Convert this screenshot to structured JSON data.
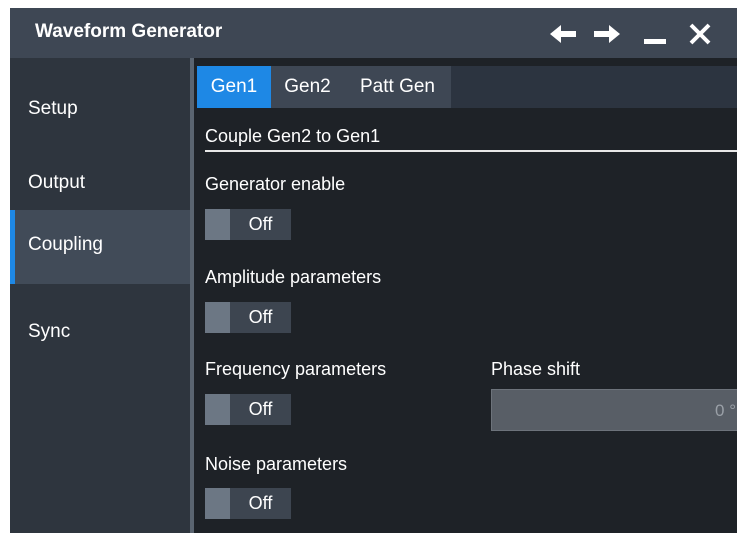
{
  "window": {
    "title": "Waveform Generator",
    "icons": [
      "back-arrow-icon",
      "forward-arrow-icon",
      "minimize-icon",
      "close-icon"
    ]
  },
  "sidebar": {
    "items": [
      {
        "label": "Setup",
        "active": false
      },
      {
        "label": "Output",
        "active": false
      },
      {
        "label": "Coupling",
        "active": true
      },
      {
        "label": "Sync",
        "active": false
      }
    ]
  },
  "tabs": [
    {
      "label": "Gen1",
      "active": true
    },
    {
      "label": "Gen2",
      "active": false
    },
    {
      "label": "Patt Gen",
      "active": false
    }
  ],
  "content": {
    "section_title": "Couple Gen2 to Gen1",
    "generator_enable": {
      "label": "Generator enable",
      "state": "Off"
    },
    "amplitude_parameters": {
      "label": "Amplitude parameters",
      "state": "Off"
    },
    "frequency_parameters": {
      "label": "Frequency parameters",
      "state": "Off"
    },
    "noise_parameters": {
      "label": "Noise parameters",
      "state": "Off"
    },
    "phase_shift": {
      "label": "Phase shift",
      "value": "0 °"
    }
  },
  "colors": {
    "accent": "#1e88e5",
    "titlebar": "#3e4754",
    "sidebar": "#2e353e",
    "background": "#1e2227"
  }
}
